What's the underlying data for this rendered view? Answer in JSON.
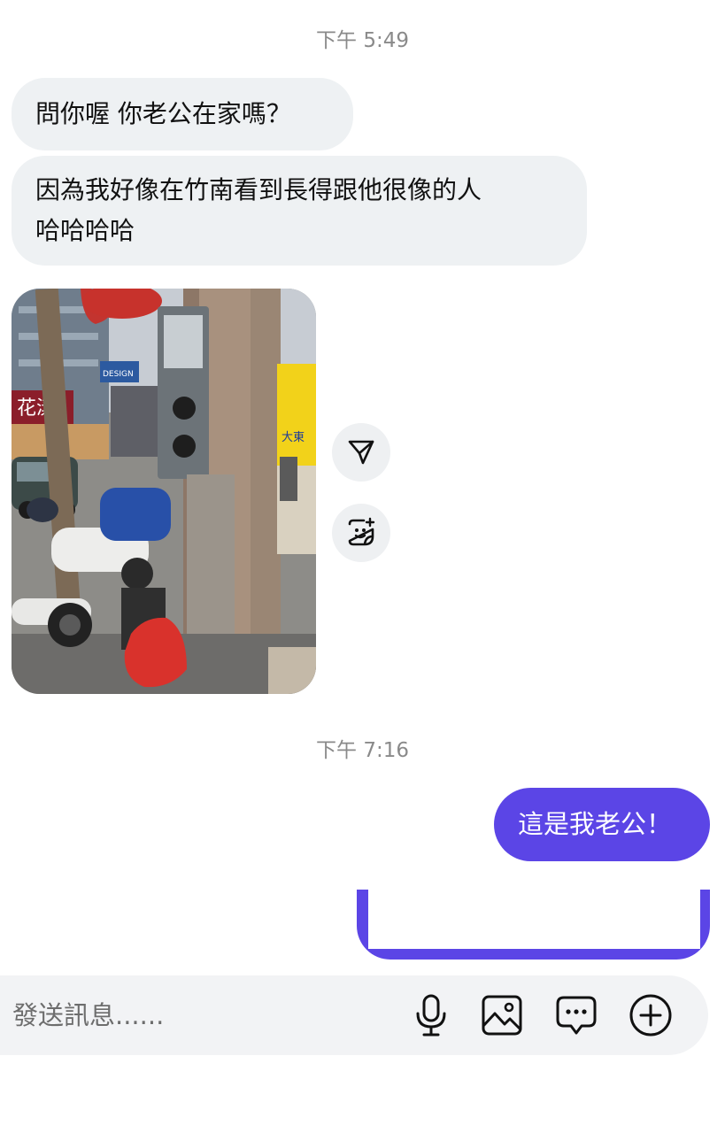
{
  "chat": {
    "timestamp_1": "下午 5:49",
    "msg_1": "問你喔 你老公在家嗎？",
    "msg_2_line1": "因為我好像在竹南看到長得跟他很像的人",
    "msg_2_line2": "哈哈哈哈",
    "photo_signs": {
      "shop_left": "花漾",
      "shop_right_brand": "大東",
      "blue_sign": "DESIGN"
    },
    "timestamp_2": "下午 7:16",
    "msg_3": "這是我老公！"
  },
  "actions": {
    "share_icon": "send-triangle-icon",
    "sticker_icon": "sticker-icon"
  },
  "composer": {
    "placeholder": "發送訊息......",
    "tools": [
      "mic-icon",
      "image-icon",
      "chat-bubble-icon",
      "plus-circle-icon"
    ]
  },
  "colors": {
    "outgoing_bubble": "#5b45e6",
    "incoming_bubble": "#eef1f3",
    "timestamp": "#8a8a8a"
  }
}
